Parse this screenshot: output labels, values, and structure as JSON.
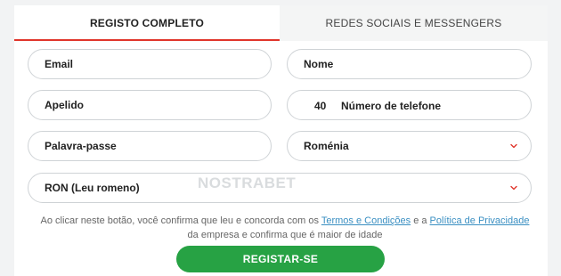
{
  "tabs": {
    "active": "REGISTO COMPLETO",
    "inactive": "REDES SOCIAIS E MESSENGERS"
  },
  "form": {
    "email_placeholder": "Email",
    "name_placeholder": "Nome",
    "surname_placeholder": "Apelido",
    "phone_code": "40",
    "phone_placeholder": "Número de telefone",
    "password_placeholder": "Palavra-passe",
    "country_value": "Roménia",
    "currency_value": "RON (Leu romeno)"
  },
  "watermark": "NOSTRABET",
  "consent": {
    "text_before": "Ao clicar neste botão, você confirma que leu e concorda com os ",
    "terms_link": "Termos e Condições",
    "text_middle": " e a ",
    "privacy_link": "Política de Privacidade",
    "text_after": " da empresa e confirma que é maior de idade"
  },
  "submit_label": "REGISTAR-SE",
  "colors": {
    "accent_red": "#e0352b",
    "button_green": "#27a244",
    "link_blue": "#3a8fc2"
  },
  "icons": {
    "dropdown": "chevron-down-icon"
  }
}
